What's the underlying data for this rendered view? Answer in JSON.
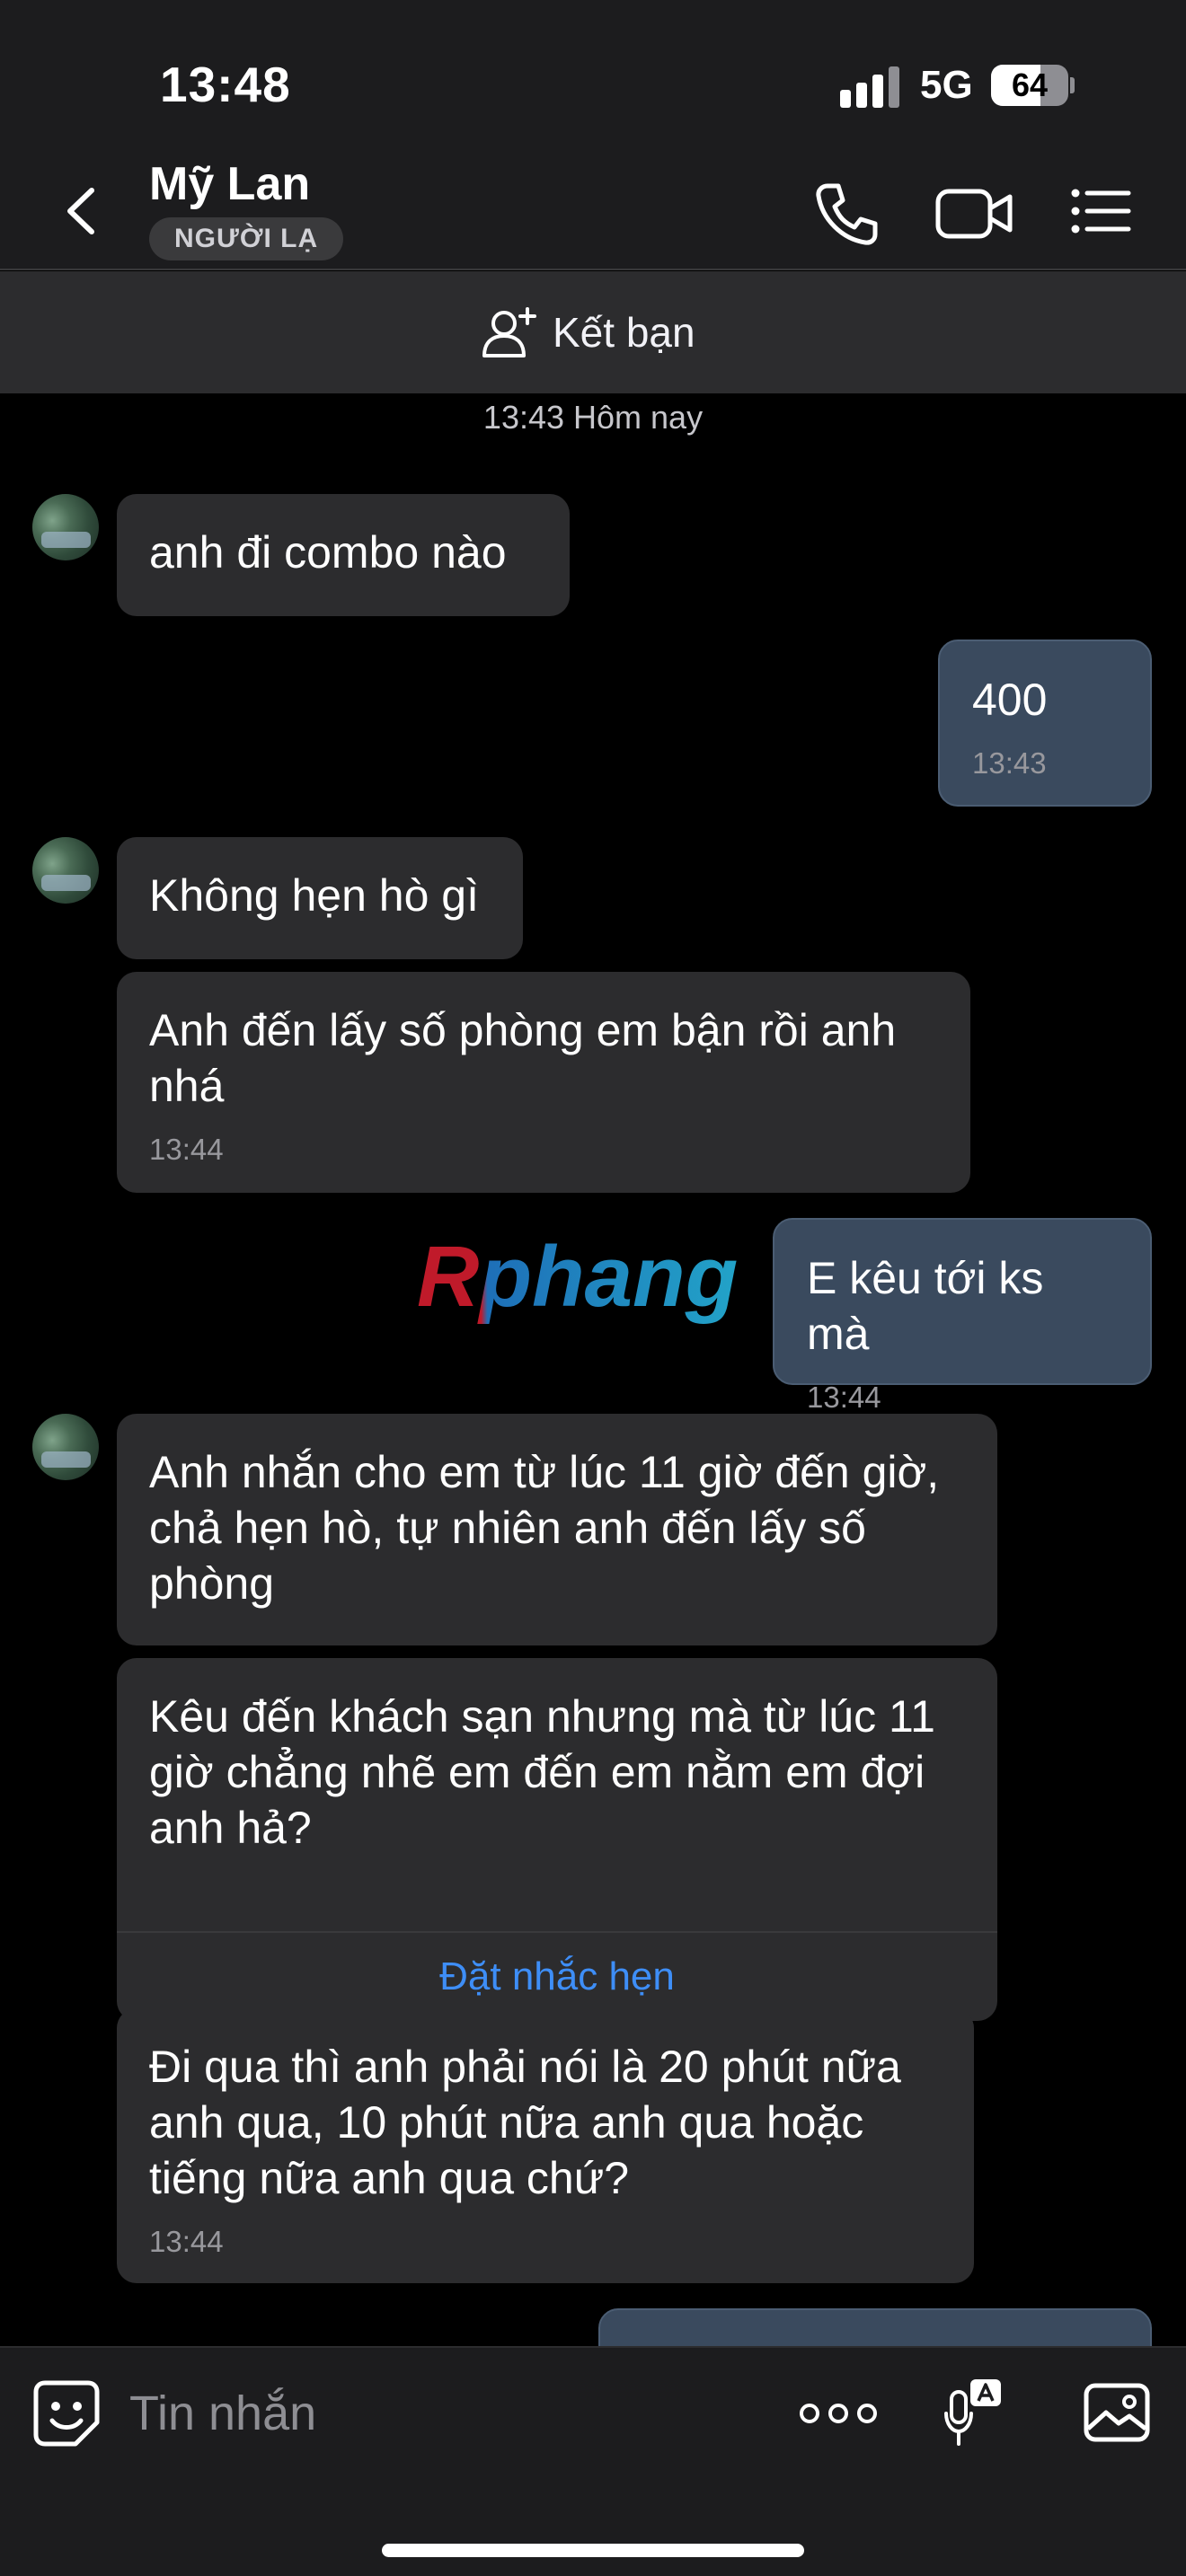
{
  "status_bar": {
    "time": "13:48",
    "network": "5G",
    "battery": "64",
    "battery_fraction": 0.64
  },
  "header": {
    "contact_name": "Mỹ Lan",
    "contact_badge": "NGƯỜI LẠ",
    "icons": [
      "back-icon",
      "phone-icon",
      "video-call-icon",
      "menu-list-icon"
    ]
  },
  "add_friend": {
    "label": "Kết bạn",
    "icon": "add-friend-icon"
  },
  "chat": {
    "date_divider": "13:43 Hôm nay",
    "watermark": "Rphang",
    "messages": [
      {
        "side": "in",
        "text": "anh đi combo  nào",
        "time": ""
      },
      {
        "side": "out",
        "text": "400",
        "time": "13:43"
      },
      {
        "side": "in",
        "text": "Không hẹn hò gì",
        "time": ""
      },
      {
        "side": "in",
        "text": "Anh đến lấy số phòng em bận rồi anh nhá",
        "time": "13:44"
      },
      {
        "side": "out",
        "text": "E kêu tới ks mà",
        "time": "13:44"
      },
      {
        "side": "in",
        "text": "Anh nhắn cho em từ lúc 11 giờ đến giờ, chả hẹn hò, tự nhiên anh đến lấy số phòng",
        "time": ""
      },
      {
        "side": "in",
        "text": "Kêu đến khách sạn nhưng mà từ lúc 11 giờ chẳng nhẽ em đến em nằm em đợi anh hả?",
        "time": "",
        "action": "Đặt nhắc hẹn"
      },
      {
        "side": "in",
        "text": "Đi qua thì anh phải nói là 20 phút nữa anh qua, 10 phút nữa anh qua hoặc tiếng nữa anh qua chứ?",
        "time": "13:44"
      }
    ]
  },
  "composer": {
    "placeholder": "Tin nhắn",
    "icons": [
      "sticker-icon",
      "more-icon",
      "voice-to-text-icon",
      "image-icon"
    ]
  }
}
